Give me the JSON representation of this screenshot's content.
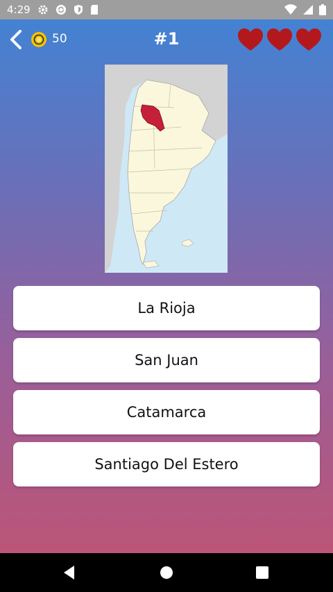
{
  "status_bar": {
    "time": "4:29",
    "icons": [
      "gear-icon",
      "sync-icon",
      "shield-icon",
      "sd-card-icon"
    ],
    "right_icons": [
      "wifi-icon",
      "signal-icon",
      "battery-icon"
    ]
  },
  "header": {
    "coins": "50",
    "title": "#1",
    "lives": 3
  },
  "map": {
    "highlighted_province_color": "#c5203a"
  },
  "answers": [
    {
      "label": "La Rioja"
    },
    {
      "label": "San Juan"
    },
    {
      "label": "Catamarca"
    },
    {
      "label": "Santiago Del Estero"
    }
  ],
  "colors": {
    "gradient_top": "#3f84d6",
    "gradient_bottom": "#c35370",
    "heart": "#b3181d"
  }
}
